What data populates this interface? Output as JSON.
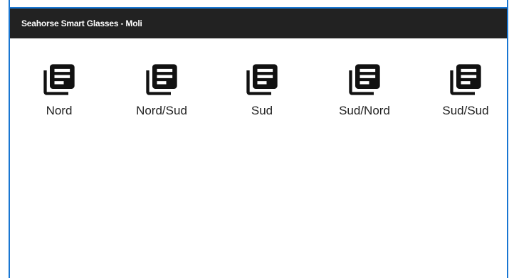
{
  "window": {
    "title": "Seahorse Smart Glasses - Moli"
  },
  "colors": {
    "titlebar_bg": "#222222",
    "accent_border": "#1976d2",
    "icon": "#111111"
  },
  "items": [
    {
      "label": "Nord",
      "icon": "library-books-icon"
    },
    {
      "label": "Nord/Sud",
      "icon": "library-books-icon"
    },
    {
      "label": "Sud",
      "icon": "library-books-icon"
    },
    {
      "label": "Sud/Nord",
      "icon": "library-books-icon"
    },
    {
      "label": "Sud/Sud",
      "icon": "library-books-icon"
    }
  ]
}
